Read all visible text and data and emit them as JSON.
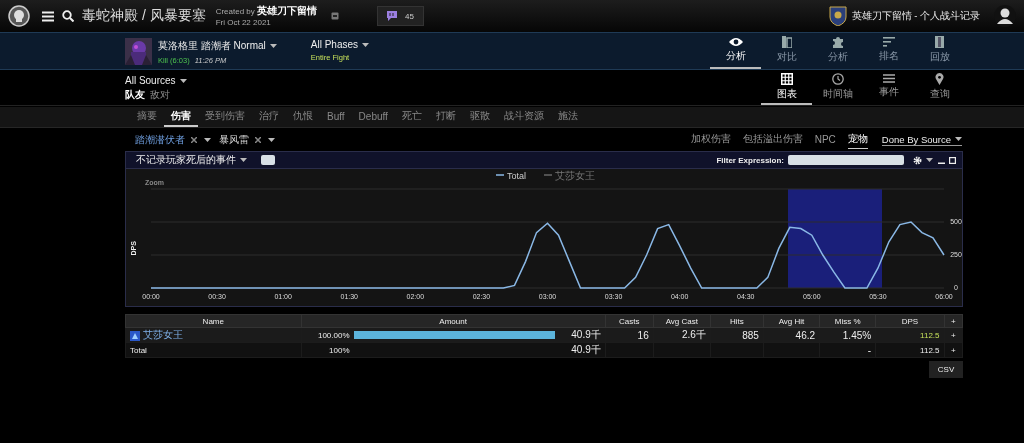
{
  "header": {
    "breadcrumb": "毒蛇神殿 / 风暴要塞",
    "created_by": "Created by **英雄刀下留情**",
    "date": "Fri Oct 22 2021",
    "comment_count": "45",
    "guild": "英雄刀下留情 - 个人战斗记录"
  },
  "fight": {
    "title": "莫洛格里 踏潮者 Normal",
    "result": "Kill (6:03)",
    "time": "11:26 PM",
    "phase": "All Phases",
    "phase_detail": "Entire Fight"
  },
  "nav_tabs": [
    {
      "label": "分析",
      "kind": "eye",
      "selected": true
    },
    {
      "label": "对比",
      "kind": "compare",
      "selected": false
    },
    {
      "label": "分析",
      "kind": "puzzle",
      "selected": false
    },
    {
      "label": "排名",
      "kind": "sort",
      "selected": false
    },
    {
      "label": "回放",
      "kind": "film",
      "selected": false
    }
  ],
  "sources": {
    "label": "All Sources",
    "filters": [
      {
        "label": "队友",
        "selected": true
      },
      {
        "label": "敌对",
        "selected": false
      }
    ]
  },
  "display_tabs": [
    {
      "label": "图表",
      "kind": "grid",
      "selected": true
    },
    {
      "label": "时间轴",
      "kind": "clock",
      "selected": false
    },
    {
      "label": "事件",
      "kind": "list",
      "selected": false
    },
    {
      "label": "查询",
      "kind": "pin",
      "selected": false
    }
  ],
  "report_tabs": [
    {
      "label": "摘要",
      "selected": false
    },
    {
      "label": "伤害",
      "selected": true
    },
    {
      "label": "受到伤害",
      "selected": false
    },
    {
      "label": "治疗",
      "selected": false
    },
    {
      "label": "仇恨",
      "selected": false
    },
    {
      "label": "Buff",
      "selected": false
    },
    {
      "label": "Debuff",
      "selected": false
    },
    {
      "label": "死亡",
      "selected": false
    },
    {
      "label": "打断",
      "selected": false
    },
    {
      "label": "驱散",
      "selected": false
    },
    {
      "label": "战斗资源",
      "selected": false
    },
    {
      "label": "施法",
      "selected": false
    }
  ],
  "target_filters": [
    {
      "label": "踏潮潜伏者",
      "selected": true
    },
    {
      "label": "暴风雷",
      "selected": false
    }
  ],
  "options": [
    {
      "label": "加权伤害",
      "selected": false
    },
    {
      "label": "包括溢出伤害",
      "selected": false
    },
    {
      "label": "NPC",
      "selected": false
    },
    {
      "label": "宠物",
      "selected": true
    }
  ],
  "grouping": "Done By Source",
  "panel": {
    "death_filter": "不记录玩家死后的事件",
    "toggle_checked": false,
    "filter_label": "Filter Expression:",
    "zoom_label": "Zoom",
    "legend": [
      {
        "name": "艾莎女王",
        "selected": false
      }
    ],
    "chart_data": {
      "type": "line",
      "ylabel": "DPS",
      "x": [
        0,
        5,
        10,
        15,
        20,
        25,
        30,
        35,
        40,
        45,
        50,
        55,
        60,
        65,
        70,
        75,
        80,
        85,
        90,
        95,
        100,
        105,
        110,
        115,
        120,
        125,
        130,
        135,
        140,
        145,
        150,
        155,
        160,
        165,
        170,
        175,
        180,
        185,
        190,
        195,
        200,
        205,
        210,
        215,
        220,
        225,
        230,
        235,
        240,
        245,
        250,
        255,
        260,
        265,
        270,
        275,
        280,
        285,
        290,
        295,
        300,
        305,
        310,
        315,
        320,
        325,
        330,
        335,
        340,
        345,
        350,
        355,
        360
      ],
      "series": [
        {
          "name": "Total",
          "color": "#8ab8e6",
          "values": [
            0,
            0,
            0,
            0,
            0,
            0,
            0,
            0,
            0,
            0,
            0,
            0,
            0,
            0,
            0,
            0,
            0,
            0,
            0,
            0,
            0,
            0,
            0,
            0,
            0,
            0,
            0,
            0,
            0,
            0,
            0,
            0,
            0,
            20,
            200,
            420,
            490,
            400,
            200,
            0,
            0,
            0,
            0,
            0,
            80,
            250,
            450,
            480,
            320,
            150,
            0,
            0,
            0,
            0,
            0,
            0,
            80,
            300,
            460,
            450,
            400,
            250,
            120,
            0,
            0,
            0,
            150,
            350,
            480,
            500,
            420,
            380,
            250
          ]
        }
      ],
      "xlim": [
        0,
        360
      ],
      "ylim": [
        0,
        750
      ],
      "xticks": [
        {
          "value": 0,
          "label": "00:00"
        },
        {
          "value": 30,
          "label": "00:30"
        },
        {
          "value": 60,
          "label": "01:00"
        },
        {
          "value": 90,
          "label": "01:30"
        },
        {
          "value": 120,
          "label": "02:00"
        },
        {
          "value": 150,
          "label": "02:30"
        },
        {
          "value": 180,
          "label": "03:00"
        },
        {
          "value": 210,
          "label": "03:30"
        },
        {
          "value": 240,
          "label": "04:00"
        },
        {
          "value": 270,
          "label": "04:30"
        },
        {
          "value": 300,
          "label": "05:00"
        },
        {
          "value": 330,
          "label": "05:30"
        },
        {
          "value": 360,
          "label": "06:00"
        }
      ],
      "yticks": [
        0,
        250,
        500
      ]
    }
  },
  "table": {
    "columns": [
      "Name",
      "Amount",
      "Casts",
      "Avg Cast",
      "Hits",
      "Avg Hit",
      "Miss %",
      "DPS",
      "+"
    ],
    "rows": [
      {
        "kind": "player",
        "name": "艾莎女王",
        "percent": "100.00%",
        "level": 1,
        "amount": "40.9千",
        "casts": "16",
        "avg_cast": "2.6千",
        "hits": "885",
        "avg_hit": "46.2",
        "miss": "1.45%",
        "dps": "112.5",
        "action": "+"
      },
      {
        "kind": "total",
        "name": "Total",
        "percent": "100%",
        "amount": "40.9千",
        "miss": "-",
        "dps": "112.5",
        "action": "+"
      }
    ]
  },
  "csv_button": "CSV"
}
